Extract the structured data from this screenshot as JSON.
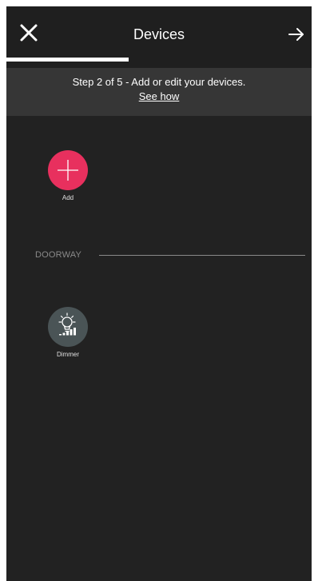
{
  "header": {
    "title": "Devices",
    "close_icon": "close-icon",
    "next_icon": "arrow-right-icon"
  },
  "progress": {
    "current_step": 2,
    "total_steps": 5,
    "fraction": 0.4
  },
  "step_banner": {
    "text": "Step 2 of 5 - Add or edit your devices.",
    "link": "See how"
  },
  "add_tile": {
    "label": "Add",
    "icon": "plus-icon",
    "color": "#e8305e"
  },
  "groups": [
    {
      "name": "DOORWAY",
      "devices": [
        {
          "label": "Dimmer",
          "icon": "dimmer-bulb-icon",
          "color": "#4a5456"
        }
      ]
    }
  ],
  "colors": {
    "background": "#222222",
    "banner": "#363636",
    "accent": "#e8305e",
    "text": "#ffffff"
  }
}
